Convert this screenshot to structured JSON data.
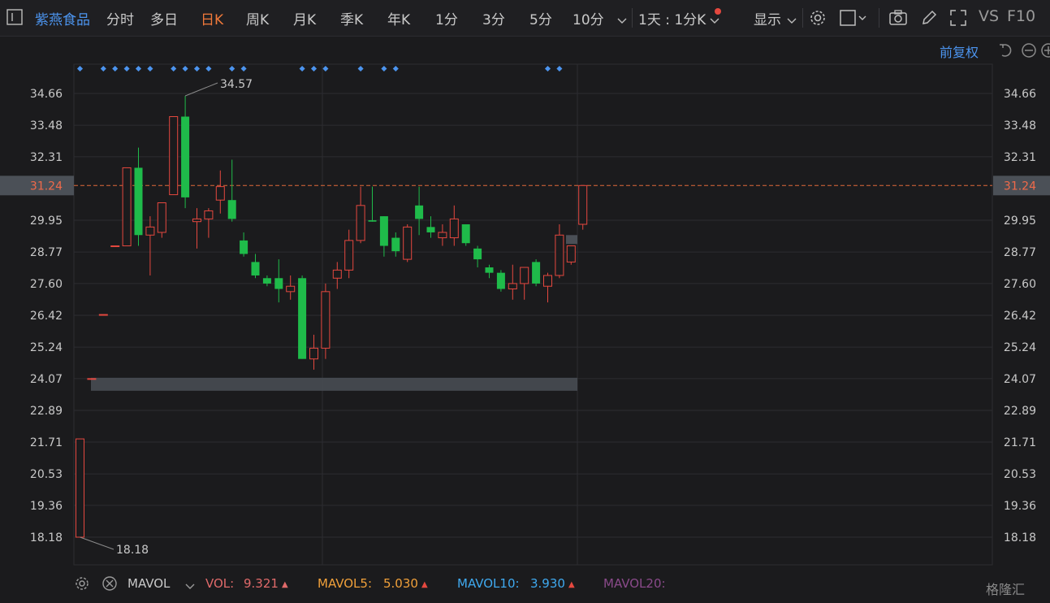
{
  "toolbar": {
    "stock_name": "紫燕食品",
    "periods": [
      "分时",
      "多日",
      "日K",
      "周K",
      "月K",
      "季K",
      "年K",
      "1分",
      "3分",
      "5分",
      "10分"
    ],
    "active_period": "日K",
    "interval_select": "1天 : 1分K",
    "display_label": "显示",
    "vs_label": "VS",
    "f10_label": "F10"
  },
  "adjust_label": "前复权",
  "bottom": {
    "indicator": "MAVOL",
    "vol_label": "VOL:",
    "vol_value": "9.321",
    "mavol5_label": "MAVOL5:",
    "mavol5_value": "5.030",
    "mavol10_label": "MAVOL10:",
    "mavol10_value": "3.930",
    "mavol20_label": "MAVOL20:",
    "watermark": "格隆汇"
  },
  "colors": {
    "up": "#e5483f",
    "down": "#1fbb4a",
    "brand": "#4c94ee",
    "active": "#f0793a",
    "grid": "#2d2d31",
    "price_line": "#e06a3a"
  },
  "chart_data": {
    "type": "candlestick",
    "yticks": [
      "34.66",
      "33.48",
      "32.31",
      "31.24",
      "29.95",
      "28.77",
      "27.60",
      "26.42",
      "25.24",
      "24.07",
      "22.89",
      "21.71",
      "20.53",
      "19.36",
      "18.18"
    ],
    "ylim": [
      18.18,
      34.66
    ],
    "current_price": "31.24",
    "annotations": {
      "high": "34.57",
      "low": "18.18"
    },
    "candles": [
      {
        "o": 18.18,
        "h": 21.83,
        "l": 18.18,
        "c": 21.83
      },
      {
        "o": 24.07,
        "h": 24.07,
        "l": 24.07,
        "c": 24.07
      },
      {
        "o": 26.45,
        "h": 26.45,
        "l": 26.45,
        "c": 26.45
      },
      {
        "o": 29.0,
        "h": 29.0,
        "l": 29.0,
        "c": 29.0
      },
      {
        "o": 29.0,
        "h": 31.9,
        "l": 29.0,
        "c": 31.9
      },
      {
        "o": 31.9,
        "h": 32.65,
        "l": 29.0,
        "c": 29.4
      },
      {
        "o": 29.4,
        "h": 30.1,
        "l": 27.9,
        "c": 29.7
      },
      {
        "o": 29.5,
        "h": 30.5,
        "l": 29.3,
        "c": 30.6
      },
      {
        "o": 30.9,
        "h": 33.8,
        "l": 30.9,
        "c": 33.8
      },
      {
        "o": 33.8,
        "h": 34.57,
        "l": 30.4,
        "c": 30.8
      },
      {
        "o": 29.9,
        "h": 30.4,
        "l": 28.9,
        "c": 30.0
      },
      {
        "o": 30.0,
        "h": 30.4,
        "l": 29.3,
        "c": 30.3
      },
      {
        "o": 30.7,
        "h": 31.8,
        "l": 30.2,
        "c": 31.2
      },
      {
        "o": 30.7,
        "h": 32.2,
        "l": 29.9,
        "c": 30.0
      },
      {
        "o": 29.2,
        "h": 29.5,
        "l": 28.6,
        "c": 28.7
      },
      {
        "o": 28.4,
        "h": 28.7,
        "l": 27.8,
        "c": 27.9
      },
      {
        "o": 27.8,
        "h": 27.9,
        "l": 27.5,
        "c": 27.6
      },
      {
        "o": 27.8,
        "h": 28.5,
        "l": 26.9,
        "c": 27.4
      },
      {
        "o": 27.3,
        "h": 27.9,
        "l": 27.0,
        "c": 27.5
      },
      {
        "o": 27.8,
        "h": 27.9,
        "l": 24.8,
        "c": 24.8
      },
      {
        "o": 24.8,
        "h": 25.7,
        "l": 24.4,
        "c": 25.2
      },
      {
        "o": 25.2,
        "h": 27.6,
        "l": 24.8,
        "c": 27.3
      },
      {
        "o": 27.8,
        "h": 28.4,
        "l": 27.4,
        "c": 28.1
      },
      {
        "o": 28.1,
        "h": 29.6,
        "l": 27.8,
        "c": 29.2
      },
      {
        "o": 29.2,
        "h": 31.2,
        "l": 29.1,
        "c": 30.5
      },
      {
        "o": 29.95,
        "h": 31.2,
        "l": 29.9,
        "c": 29.9
      },
      {
        "o": 30.1,
        "h": 30.1,
        "l": 28.6,
        "c": 29.0
      },
      {
        "o": 29.3,
        "h": 29.5,
        "l": 28.6,
        "c": 28.8
      },
      {
        "o": 28.5,
        "h": 29.8,
        "l": 28.4,
        "c": 29.7
      },
      {
        "o": 30.5,
        "h": 31.2,
        "l": 29.4,
        "c": 30.0
      },
      {
        "o": 29.7,
        "h": 30.1,
        "l": 29.3,
        "c": 29.5
      },
      {
        "o": 29.3,
        "h": 29.8,
        "l": 29.0,
        "c": 29.5
      },
      {
        "o": 29.3,
        "h": 30.5,
        "l": 29.0,
        "c": 30.0
      },
      {
        "o": 29.8,
        "h": 29.8,
        "l": 29.0,
        "c": 29.1
      },
      {
        "o": 28.9,
        "h": 29.0,
        "l": 28.2,
        "c": 28.5
      },
      {
        "o": 28.2,
        "h": 28.3,
        "l": 27.8,
        "c": 28.0
      },
      {
        "o": 28.0,
        "h": 28.1,
        "l": 27.3,
        "c": 27.4
      },
      {
        "o": 27.4,
        "h": 28.3,
        "l": 27.0,
        "c": 27.6
      },
      {
        "o": 27.6,
        "h": 28.2,
        "l": 27.0,
        "c": 28.2
      },
      {
        "o": 28.4,
        "h": 28.5,
        "l": 27.5,
        "c": 27.6
      },
      {
        "o": 27.5,
        "h": 28.0,
        "l": 26.9,
        "c": 27.9
      },
      {
        "o": 27.9,
        "h": 29.8,
        "l": 27.8,
        "c": 29.4
      },
      {
        "o": 28.4,
        "h": 29.0,
        "l": 28.3,
        "c": 29.0
      },
      {
        "o": 29.8,
        "h": 31.24,
        "l": 29.6,
        "c": 31.24
      }
    ],
    "marker_dot_candles": [
      0,
      2,
      3,
      4,
      5,
      6,
      8,
      9,
      10,
      11,
      13,
      14,
      19,
      20,
      21,
      24,
      26,
      27,
      40,
      41
    ],
    "grid": true
  }
}
